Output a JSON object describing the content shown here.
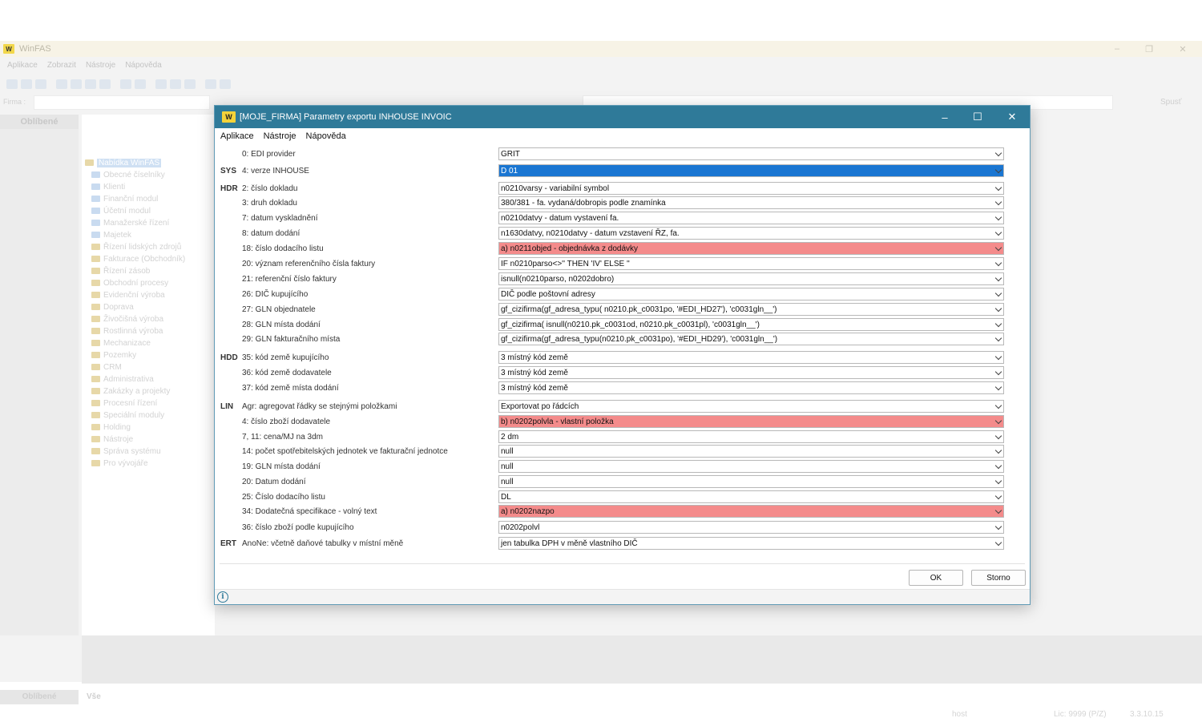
{
  "app": {
    "title": "WinFAS",
    "menu": [
      "Aplikace",
      "Zobrazit",
      "Nástroje",
      "Nápověda"
    ],
    "firma_label": "Firma :",
    "spustit_label": "Spusť",
    "side_header": "Oblíbené",
    "tree_root": "Nabídka WinFAS",
    "tree_items": [
      "Obecné číselníky",
      "Klienti",
      "Finanční modul",
      "Účetní modul",
      "Manažerské řízení",
      "Majetek",
      "Řízení lidských zdrojů",
      "Fakturace (Obchodník)",
      "Řízení zásob",
      "Obchodní procesy",
      "Evidenční výroba",
      "Doprava",
      "Živočišná výroba",
      "Rostlinná výroba",
      "Mechanizace",
      "Pozemky",
      "CRM",
      "Administrativa",
      "Zakázky a projekty",
      "Procesní řízení",
      "Speciální moduly",
      "Holding",
      "Nástroje",
      "Správa systému",
      "Pro vývojáře"
    ],
    "bottom_tab_1": "Oblíbené",
    "bottom_tab_2": "Vše",
    "status_host": "host",
    "status_lic": "Lic: 9999  (P/Z)",
    "status_version": "3.3.10.15"
  },
  "dialog": {
    "title": "[MOJE_FIRMA] Parametry exportu INHOUSE INVOIC",
    "menu": [
      "Aplikace",
      "Nástroje",
      "Nápověda"
    ],
    "ok_label": "OK",
    "cancel_label": "Storno",
    "rows": [
      {
        "section": "",
        "label": "0: EDI provider",
        "value": "GRIT",
        "state": ""
      },
      {
        "section": "SYS",
        "label": "4: verze INHOUSE",
        "value": "D 01",
        "state": "selected"
      },
      {
        "section": "HDR",
        "label": "2: číslo dokladu",
        "value": "n0210varsy - variabilní symbol",
        "state": ""
      },
      {
        "section": "",
        "label": "3: druh dokladu",
        "value": "380/381 - fa. vydaná/dobropis podle znamínka",
        "state": ""
      },
      {
        "section": "",
        "label": "7: datum vyskladnění",
        "value": "n0210datvy - datum vystavení fa.",
        "state": ""
      },
      {
        "section": "",
        "label": "8: datum dodání",
        "value": "n1630datvy, n0210datvy - datum vzstavení ŘZ, fa.",
        "state": ""
      },
      {
        "section": "",
        "label": "18: číslo dodacího listu",
        "value": "a) n0211objed - objednávka z dodávky",
        "state": "error"
      },
      {
        "section": "",
        "label": "20: význam referenčního čísla faktury",
        "value": "IF n0210parso<>'' THEN 'IV' ELSE ''",
        "state": ""
      },
      {
        "section": "",
        "label": "21: referenční číslo faktury",
        "value": "isnull(n0210parso, n0202dobro)",
        "state": ""
      },
      {
        "section": "",
        "label": "26: DIČ kupujícího",
        "value": "DIČ podle poštovní adresy",
        "state": ""
      },
      {
        "section": "",
        "label": "27: GLN objednatele",
        "value": "gf_cizifirma(gf_adresa_typu( n0210.pk_c0031po, '#EDI_HD27'), 'c0031gln__')",
        "state": ""
      },
      {
        "section": "",
        "label": "28: GLN místa dodání",
        "value": "gf_cizifirma( isnull(n0210.pk_c0031od, n0210.pk_c0031pl), 'c0031gln__')",
        "state": ""
      },
      {
        "section": "",
        "label": "29: GLN fakturačního místa",
        "value": "gf_cizifirma(gf_adresa_typu(n0210.pk_c0031po), '#EDI_HD29'), 'c0031gln__')",
        "state": ""
      },
      {
        "section": "HDD",
        "label": "35: kód země kupujícího",
        "value": "3 místný kód země",
        "state": ""
      },
      {
        "section": "",
        "label": "36: kód země dodavatele",
        "value": "3 místný kód země",
        "state": ""
      },
      {
        "section": "",
        "label": "37: kód země místa dodání",
        "value": "3 místný kód země",
        "state": ""
      },
      {
        "section": "LIN",
        "label": "Agr: agregovat řádky se stejnými položkami",
        "value": "Exportovat po řádcích",
        "state": ""
      },
      {
        "section": "",
        "label": "4: číslo zboží dodavatele",
        "value": "b) n0202polvla - vlastní položka",
        "state": "error"
      },
      {
        "section": "",
        "label": "7, 11: cena/MJ na 3dm",
        "value": "2 dm",
        "state": ""
      },
      {
        "section": "",
        "label": "14: počet spotřebitelských jednotek ve fakturační jednotce",
        "value": "null",
        "state": ""
      },
      {
        "section": "",
        "label": "19: GLN místa dodání",
        "value": "null",
        "state": ""
      },
      {
        "section": "",
        "label": "20: Datum dodání",
        "value": "null",
        "state": ""
      },
      {
        "section": "",
        "label": "25: Číslo dodacího listu",
        "value": "DL",
        "state": ""
      },
      {
        "section": "",
        "label": "34: Dodatečná specifikace - volný text",
        "value": "a) n0202nazpo",
        "state": "error"
      },
      {
        "section": "",
        "label": "36: číslo zboží podle kupujícího",
        "value": "n0202polvl",
        "state": ""
      },
      {
        "section": "ERT",
        "label": "AnoNe: včetně daňové tabulky v místní měně",
        "value": "jen tabulka DPH v měně vlastního DIČ",
        "state": ""
      }
    ]
  }
}
